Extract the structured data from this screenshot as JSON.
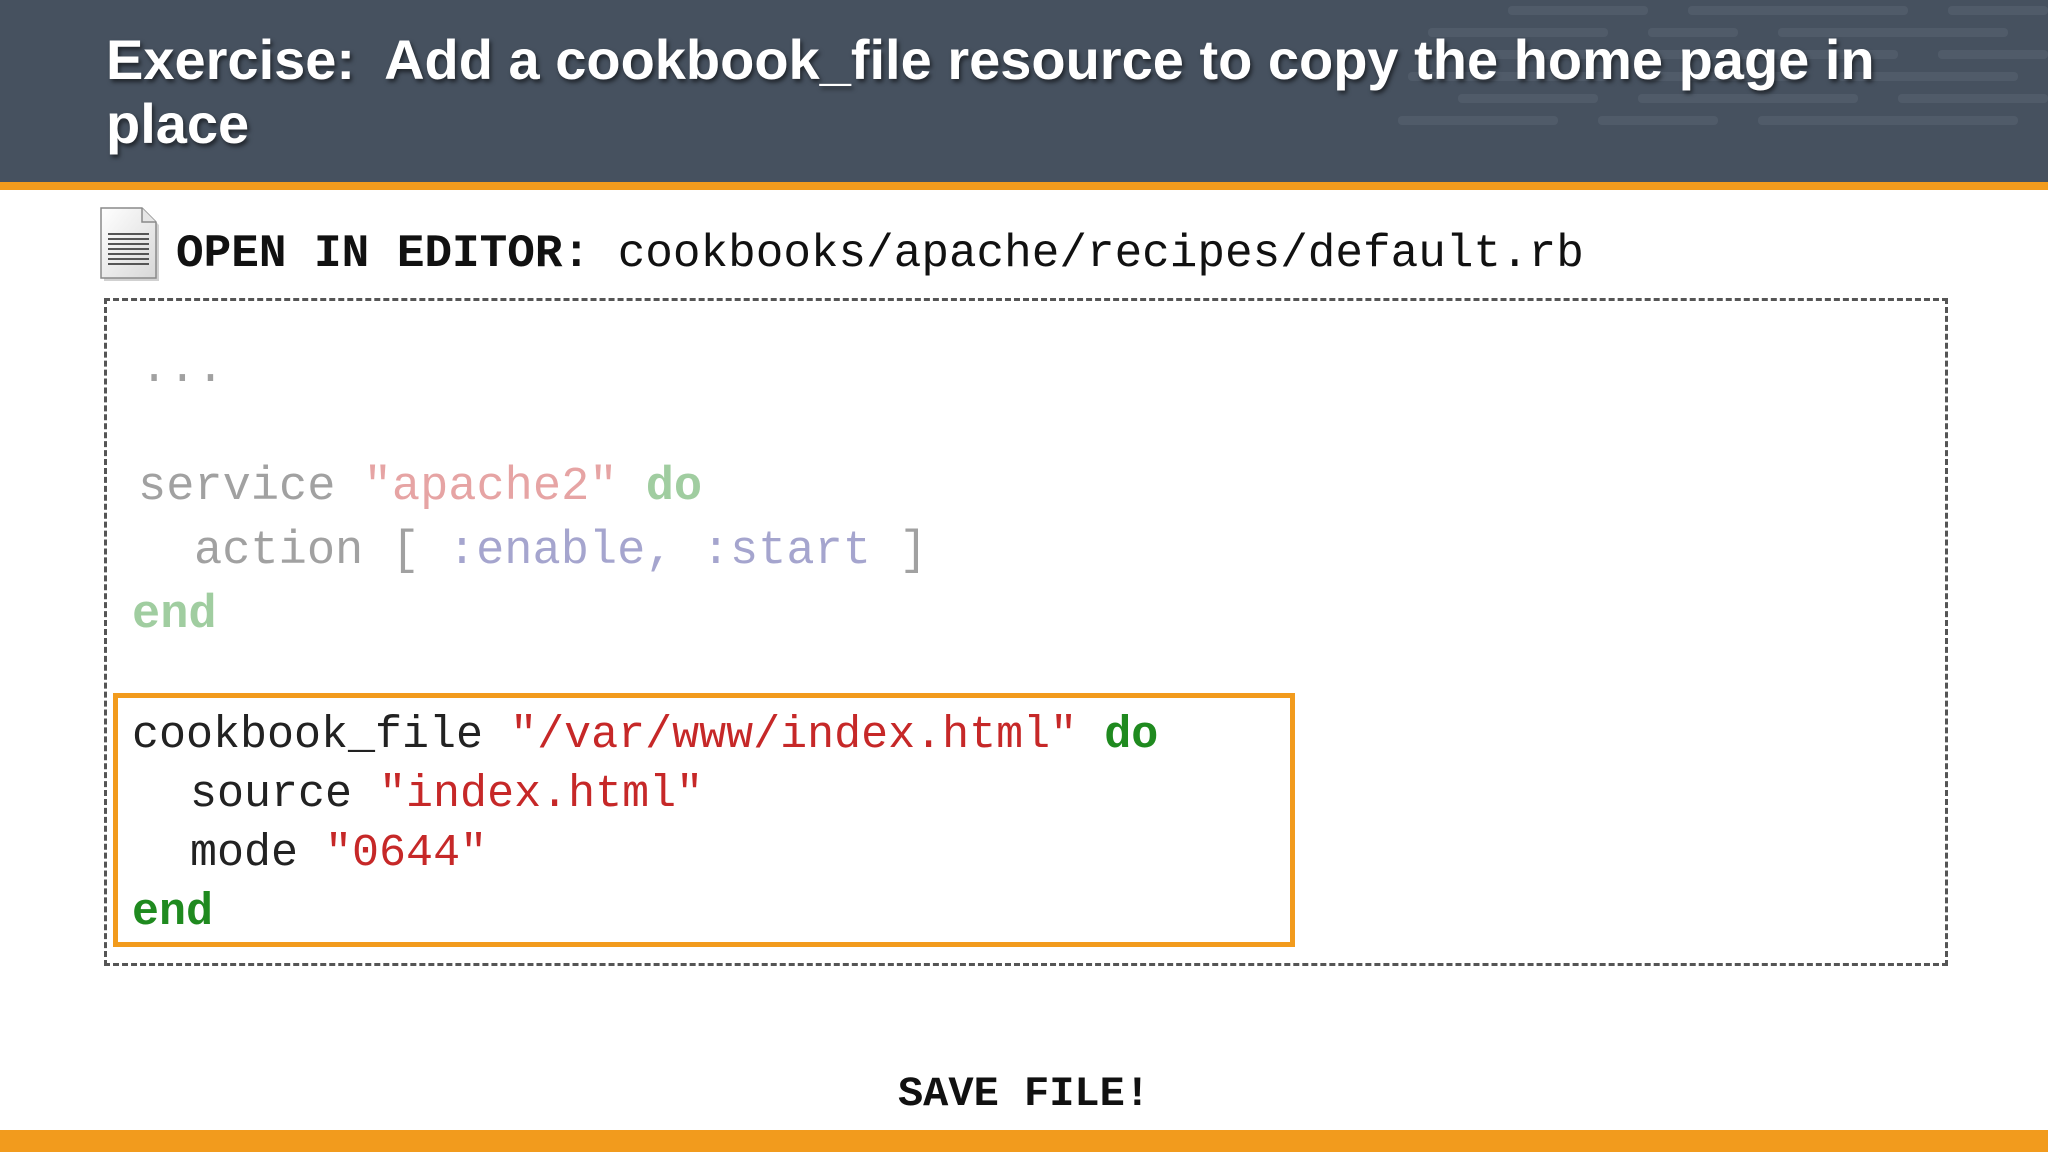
{
  "slide": {
    "title": "Exercise:  Add a cookbook_file resource to copy the home page in place",
    "open_label": "OPEN IN EDITOR:",
    "file_path": "cookbooks/apache/recipes/default.rb",
    "save_text": "SAVE FILE!",
    "icons": {
      "file": "document-icon"
    },
    "colors": {
      "header": "#46515f",
      "accent": "#f29b1d",
      "string": "#c62828",
      "keyword": "#1f8a1f",
      "symbol": "#2c2a8c"
    }
  },
  "code": {
    "ellipsis": "...",
    "service": {
      "kw": "service",
      "name": "\"apache2\"",
      "do": "do",
      "action_kw": "action",
      "bracket_open": "[",
      "sym1": ":enable,",
      "sym2": ":start",
      "bracket_close": "]",
      "end": "end"
    },
    "cookbook_file": {
      "kw": "cookbook_file",
      "path": "\"/var/www/index.html\"",
      "do": "do",
      "source_kw": "source",
      "source_val": "\"index.html\"",
      "mode_kw": "mode",
      "mode_val": "\"0644\"",
      "end": "end"
    }
  }
}
